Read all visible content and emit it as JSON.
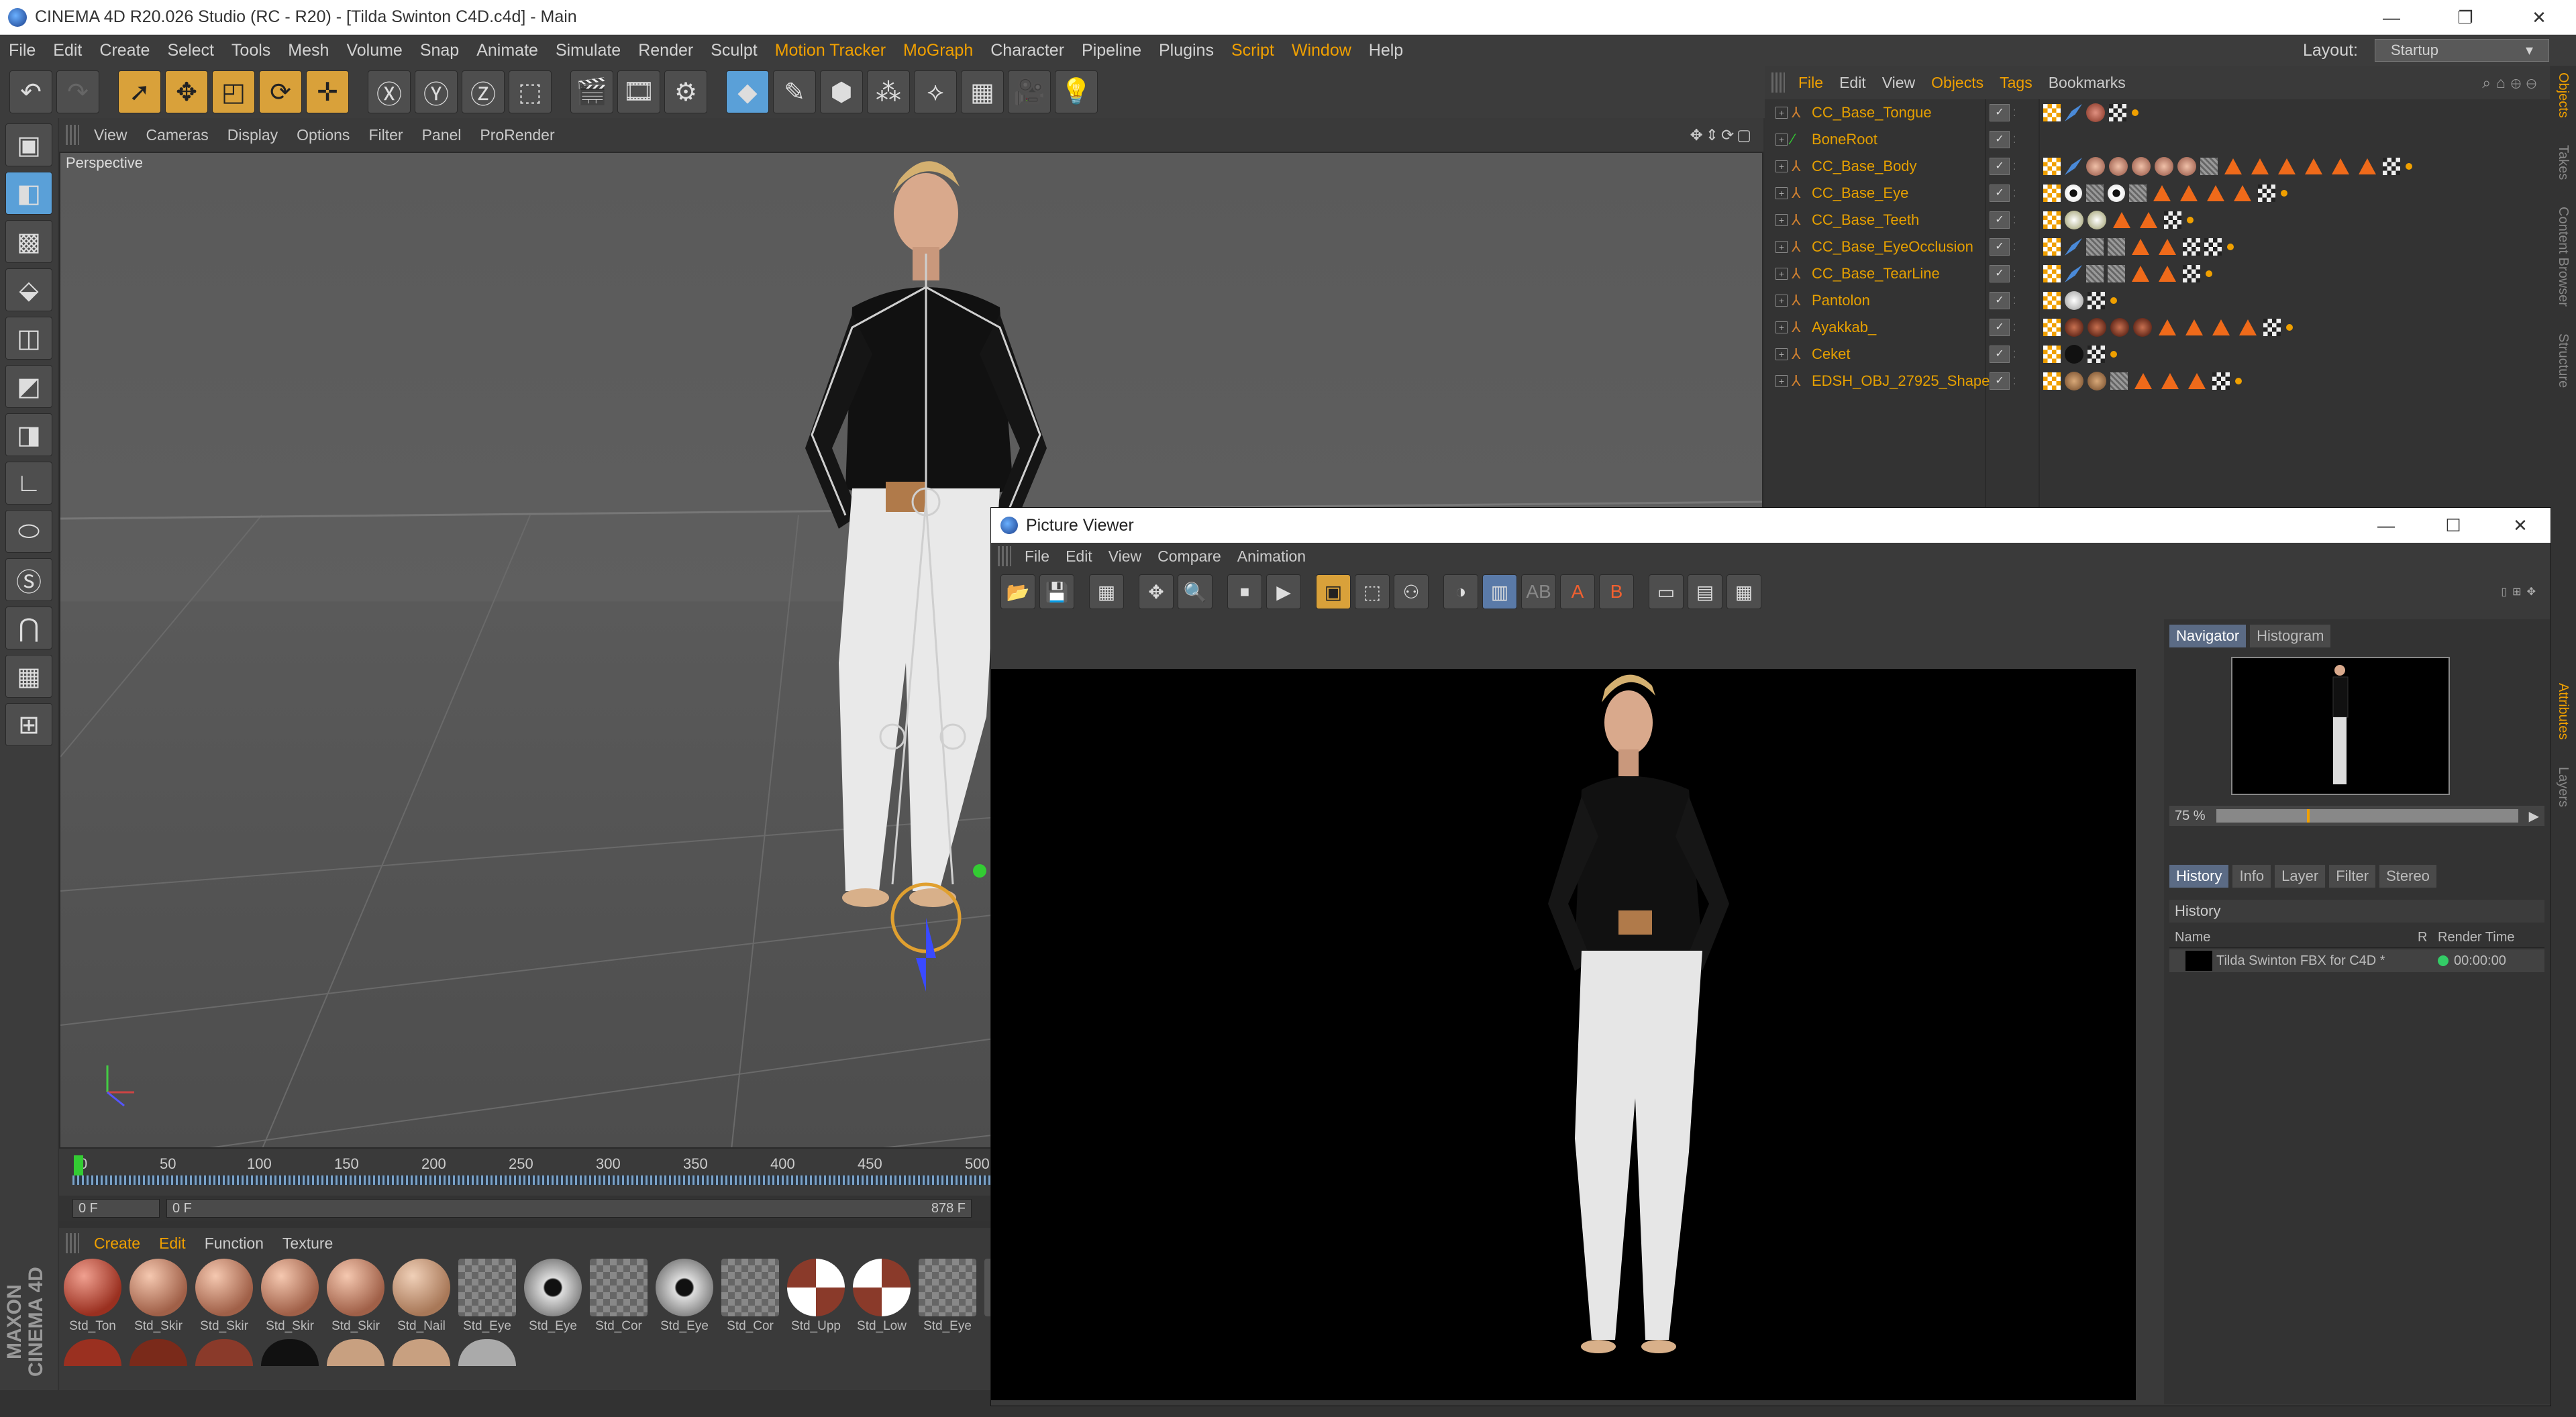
{
  "window": {
    "title": "CINEMA 4D R20.026 Studio (RC - R20) - [Tilda Swinton C4D.c4d] - Main"
  },
  "menu": [
    "File",
    "Edit",
    "Create",
    "Select",
    "Tools",
    "Mesh",
    "Volume",
    "Snap",
    "Animate",
    "Simulate",
    "Render",
    "Sculpt",
    "Motion Tracker",
    "MoGraph",
    "Character",
    "Pipeline",
    "Plugins",
    "Script",
    "Window",
    "Help"
  ],
  "layout": {
    "label": "Layout:",
    "value": "Startup"
  },
  "viewport": {
    "menu": [
      "View",
      "Cameras",
      "Display",
      "Options",
      "Filter",
      "Panel",
      "ProRender"
    ],
    "label": "Perspective"
  },
  "timeline": {
    "ticks": [
      "0",
      "50",
      "100",
      "150",
      "200",
      "250",
      "300",
      "350",
      "400",
      "450",
      "500"
    ],
    "current": "0 F",
    "start": "0 F",
    "end": "878 F"
  },
  "materials": {
    "menu": [
      "Create",
      "Edit",
      "Function",
      "Texture"
    ],
    "items": [
      "Std_Ton",
      "Std_Skir",
      "Std_Skir",
      "Std_Skir",
      "Std_Skir",
      "Std_Nail",
      "Std_Eye",
      "Std_Eye",
      "Std_Cor",
      "Std_Eye",
      "Std_Cor",
      "Std_Upp",
      "Std_Low",
      "Std_Eye",
      "S"
    ],
    "brand": "MAXON CINEMA 4D"
  },
  "objects": {
    "menu": [
      "File",
      "Edit",
      "View",
      "Objects",
      "Tags",
      "Bookmarks"
    ],
    "rows": [
      {
        "name": "CC_Base_Tongue"
      },
      {
        "name": "BoneRoot"
      },
      {
        "name": "CC_Base_Body"
      },
      {
        "name": "CC_Base_Eye"
      },
      {
        "name": "CC_Base_Teeth"
      },
      {
        "name": "CC_Base_EyeOcclusion"
      },
      {
        "name": "CC_Base_TearLine"
      },
      {
        "name": "Pantolon"
      },
      {
        "name": "Ayakkab_"
      },
      {
        "name": "Ceket"
      },
      {
        "name": "EDSH_OBJ_27925_Shape"
      }
    ]
  },
  "siderail": [
    "Objects",
    "Takes",
    "Content Browser",
    "Structure",
    "Attributes",
    "Layers"
  ],
  "picture_viewer": {
    "title": "Picture Viewer",
    "menu": [
      "File",
      "Edit",
      "View",
      "Compare",
      "Animation"
    ],
    "side_tabs": [
      "Navigator",
      "Histogram"
    ],
    "zoom": "75 %",
    "hist_tabs": [
      "History",
      "Info",
      "Layer",
      "Filter",
      "Stereo"
    ],
    "history_header": "History",
    "columns": {
      "name": "Name",
      "r": "R",
      "time": "Render Time"
    },
    "row": {
      "name": "Tilda Swinton FBX for C4D *",
      "time": "00:00:00"
    }
  }
}
